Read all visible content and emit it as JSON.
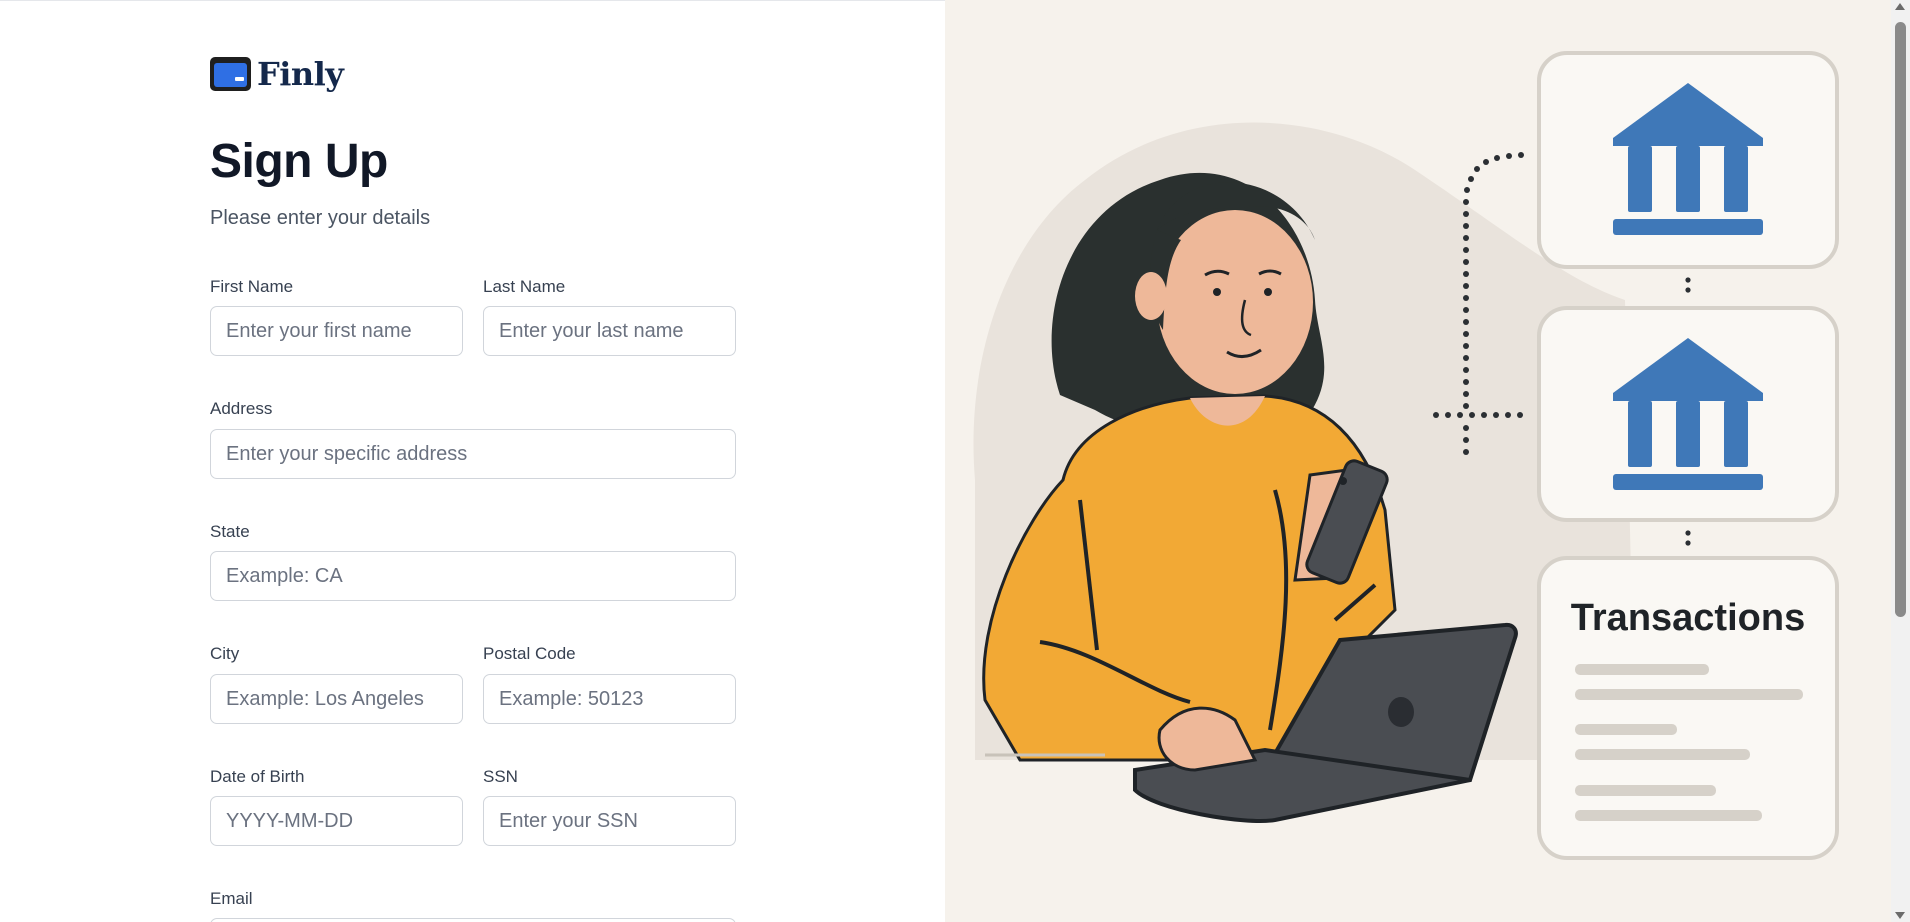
{
  "app": {
    "logo_text": "Finly"
  },
  "page": {
    "title": "Sign Up",
    "subtitle": "Please enter your details"
  },
  "form": {
    "first_name": {
      "label": "First Name",
      "placeholder": "Enter your first name",
      "value": ""
    },
    "last_name": {
      "label": "Last Name",
      "placeholder": "Enter your last name",
      "value": ""
    },
    "address": {
      "label": "Address",
      "placeholder": "Enter your specific address",
      "value": ""
    },
    "state": {
      "label": "State",
      "placeholder": "Example: CA",
      "value": ""
    },
    "city": {
      "label": "City",
      "placeholder": "Example: Los Angeles",
      "value": ""
    },
    "postal_code": {
      "label": "Postal Code",
      "placeholder": "Example: 50123",
      "value": ""
    },
    "dob": {
      "label": "Date of Birth",
      "placeholder": "YYYY-MM-DD",
      "value": ""
    },
    "ssn": {
      "label": "SSN",
      "placeholder": "Enter your SSN",
      "value": ""
    },
    "email": {
      "label": "Email",
      "placeholder": "",
      "value": ""
    }
  },
  "illustration": {
    "card_title": "Transactions",
    "icons": [
      "bank-icon",
      "bank-icon",
      "credit-card-icon",
      "laptop-icon",
      "phone-icon"
    ]
  },
  "colors": {
    "brand_blue": "#2f6fe4",
    "bank_blue": "#3f78b8",
    "illustration_bg": "#f6f2ec",
    "sweater": "#f2a935"
  }
}
